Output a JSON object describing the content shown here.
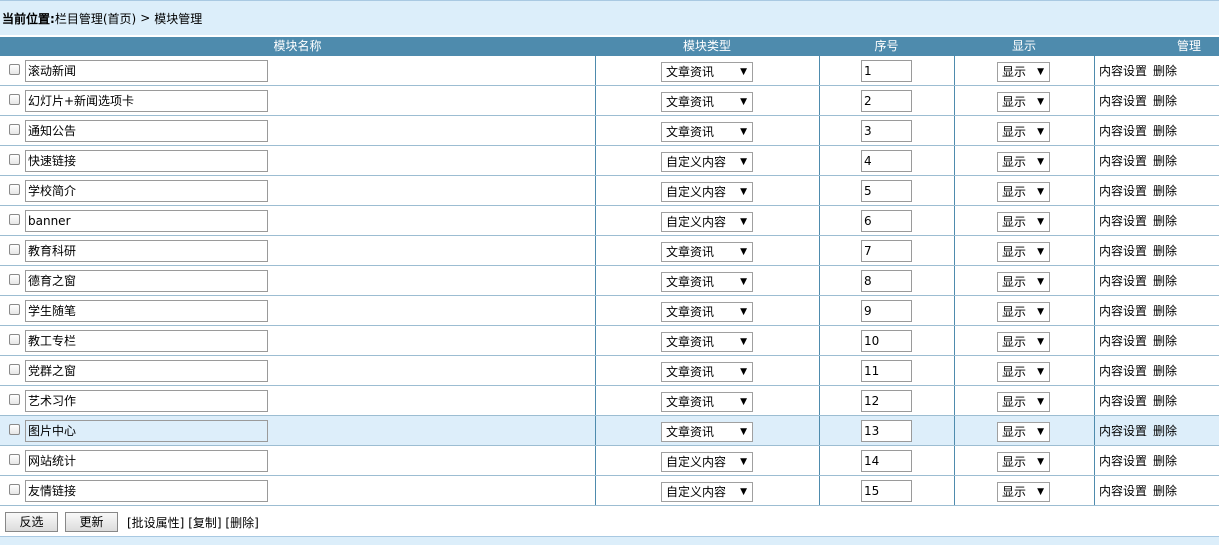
{
  "breadcrumb": {
    "label": "当前位置:",
    "path1": "栏目管理(首页)",
    "separator": ">",
    "path2": "模块管理"
  },
  "table": {
    "headers": {
      "name": "模块名称",
      "type": "模块类型",
      "order": "序号",
      "display": "显示",
      "manage": "管理"
    },
    "rows": [
      {
        "name": "滚动新闻",
        "type": "文章资讯",
        "order": "1",
        "display": "显示"
      },
      {
        "name": "幻灯片+新闻选项卡",
        "type": "文章资讯",
        "order": "2",
        "display": "显示"
      },
      {
        "name": "通知公告",
        "type": "文章资讯",
        "order": "3",
        "display": "显示"
      },
      {
        "name": "快速链接",
        "type": "自定义内容",
        "order": "4",
        "display": "显示"
      },
      {
        "name": "学校简介",
        "type": "自定义内容",
        "order": "5",
        "display": "显示"
      },
      {
        "name": "banner",
        "type": "自定义内容",
        "order": "6",
        "display": "显示"
      },
      {
        "name": "教育科研",
        "type": "文章资讯",
        "order": "7",
        "display": "显示"
      },
      {
        "name": "德育之窗",
        "type": "文章资讯",
        "order": "8",
        "display": "显示"
      },
      {
        "name": "学生随笔",
        "type": "文章资讯",
        "order": "9",
        "display": "显示"
      },
      {
        "name": "教工专栏",
        "type": "文章资讯",
        "order": "10",
        "display": "显示"
      },
      {
        "name": "党群之窗",
        "type": "文章资讯",
        "order": "11",
        "display": "显示"
      },
      {
        "name": "艺术习作",
        "type": "文章资讯",
        "order": "12",
        "display": "显示"
      },
      {
        "name": "图片中心",
        "type": "文章资讯",
        "order": "13",
        "display": "显示"
      },
      {
        "name": "网站统计",
        "type": "自定义内容",
        "order": "14",
        "display": "显示"
      },
      {
        "name": "友情链接",
        "type": "自定义内容",
        "order": "15",
        "display": "显示"
      }
    ],
    "actions": {
      "content_settings": "内容设置",
      "delete": "删除"
    },
    "dropdown_arrow": "▼",
    "highlighted_row": 12
  },
  "footer": {
    "invert_button": "反选",
    "update_button": "更新",
    "batch_attr": "[批设属性]",
    "copy": "[复制]",
    "delete": "[删除]"
  },
  "colors": {
    "header_bg": "#4e8bad",
    "breadcrumb_bg": "#dceefa",
    "highlight_row": "#ddeefa"
  }
}
